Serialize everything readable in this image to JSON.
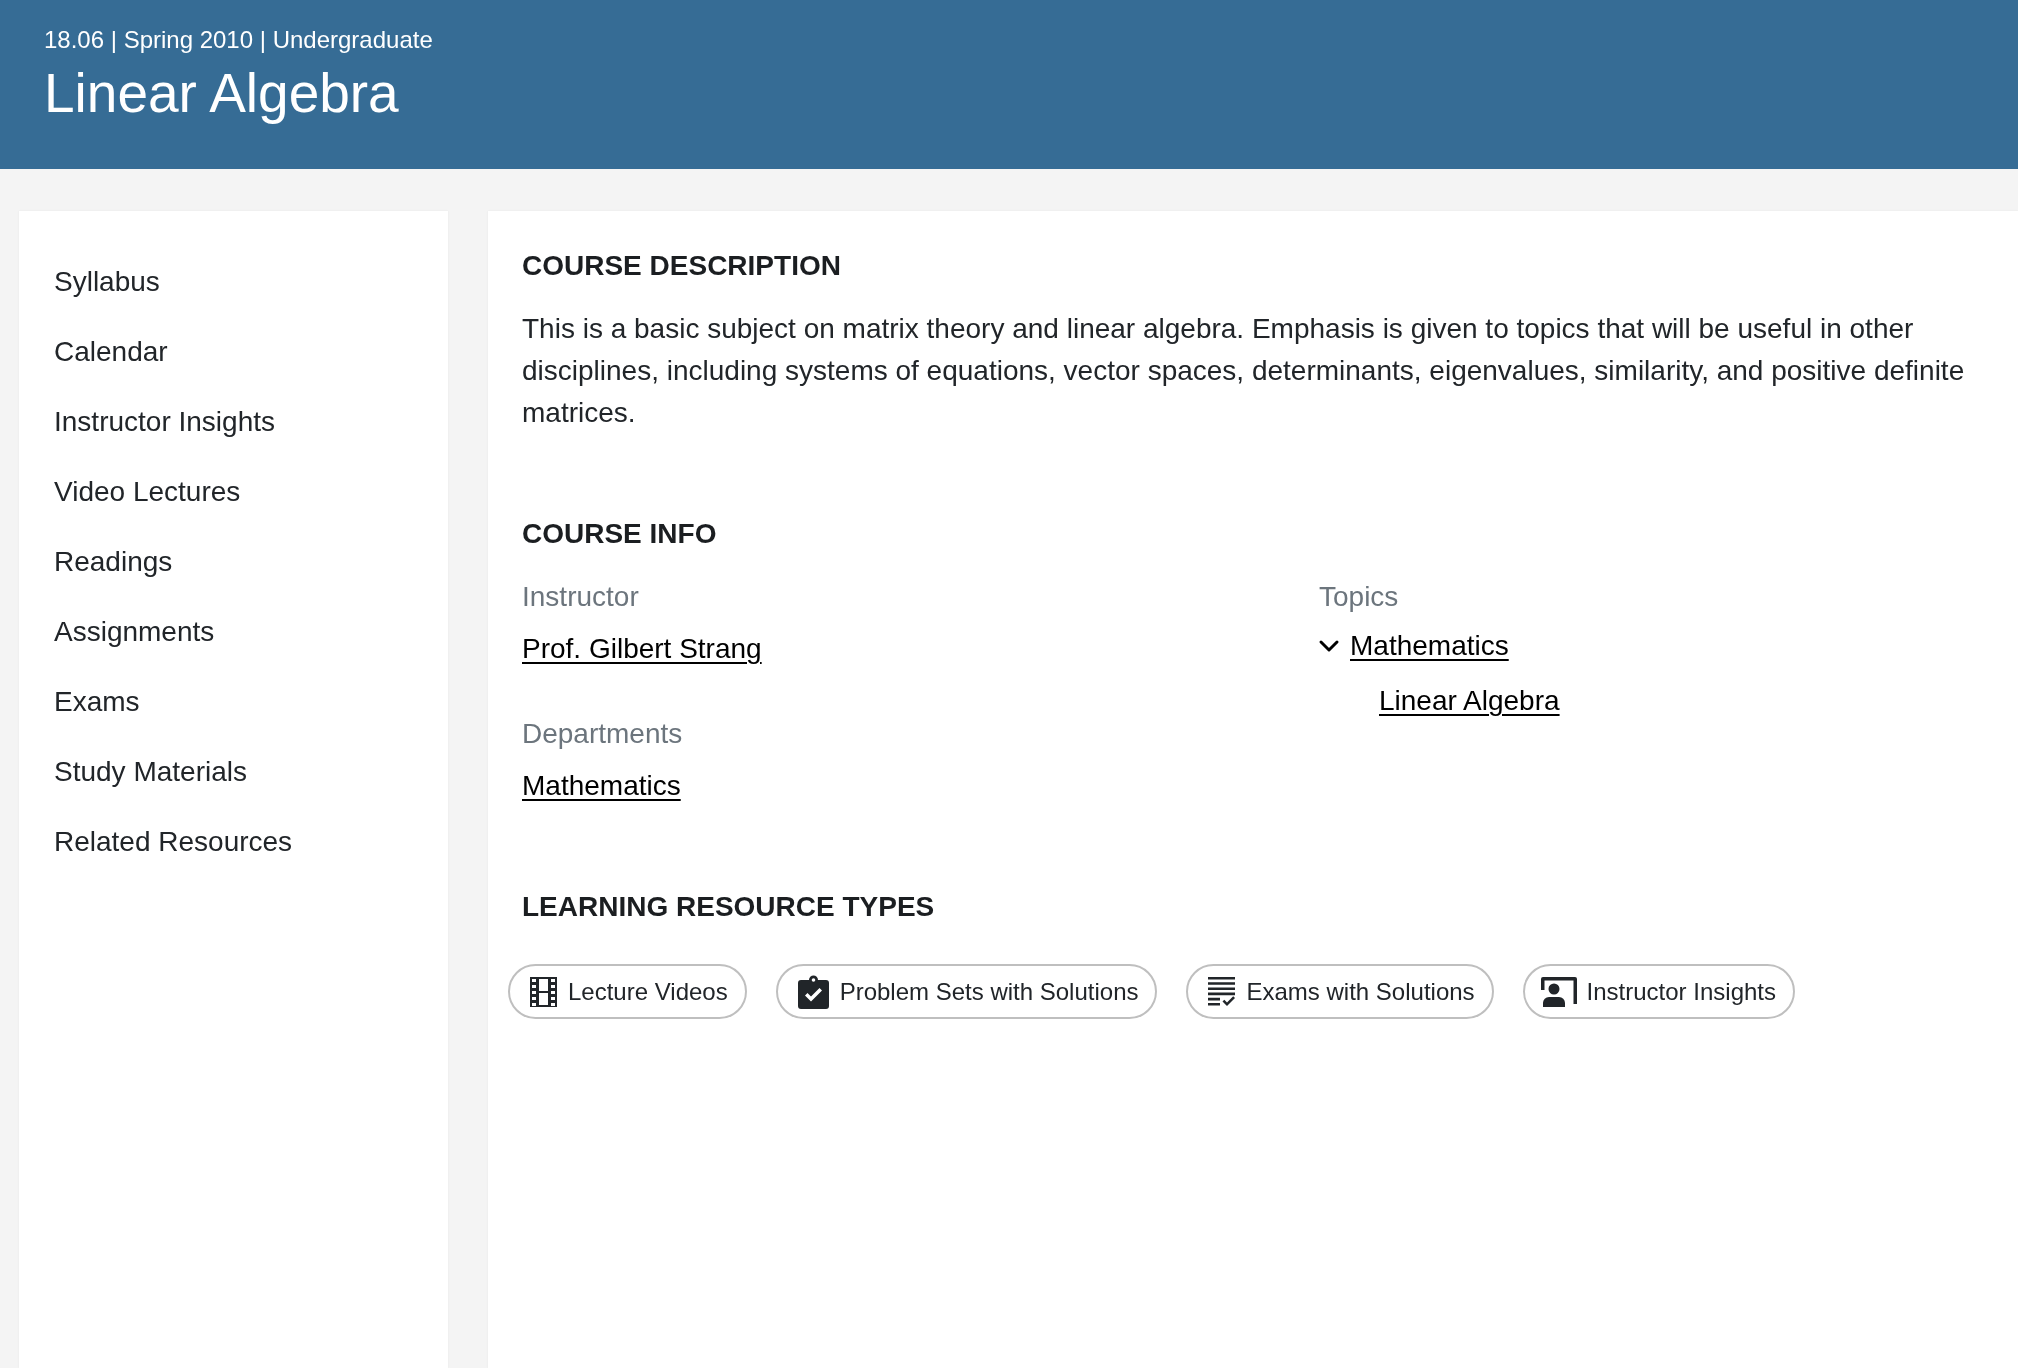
{
  "header": {
    "subtitle": "18.06 | Spring 2010 | Undergraduate",
    "title": "Linear Algebra"
  },
  "sidebar": {
    "items": [
      "Syllabus",
      "Calendar",
      "Instructor Insights",
      "Video Lectures",
      "Readings",
      "Assignments",
      "Exams",
      "Study Materials",
      "Related Resources"
    ]
  },
  "course_description": {
    "heading": "COURSE DESCRIPTION",
    "text": "This is a basic subject on matrix theory and linear algebra. Emphasis is given to topics that will be useful in other disciplines, including systems of equations, vector spaces, determinants, eigenvalues, similarity, and positive definite matrices."
  },
  "course_info": {
    "heading": "COURSE INFO",
    "instructor": {
      "label": "Instructor",
      "names": [
        "Prof. Gilbert Strang"
      ]
    },
    "departments": {
      "label": "Departments",
      "names": [
        "Mathematics"
      ]
    },
    "topics": {
      "label": "Topics",
      "items": [
        {
          "label": "Mathematics",
          "expanded": true,
          "children": [
            {
              "label": "Linear Algebra"
            }
          ]
        }
      ]
    }
  },
  "learning_resource_types": {
    "heading": "LEARNING RESOURCE TYPES",
    "items": [
      {
        "label": "Lecture Videos",
        "kind": "video"
      },
      {
        "label": "Problem Sets with Solutions",
        "kind": "problem_set"
      },
      {
        "label": "Exams with Solutions",
        "kind": "exam"
      },
      {
        "label": "Instructor Insights",
        "kind": "instructor"
      }
    ]
  }
}
